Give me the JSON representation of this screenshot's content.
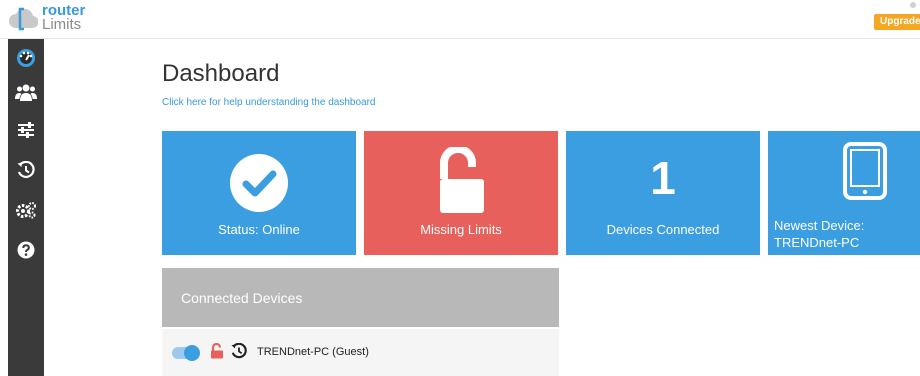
{
  "header": {
    "logo_line1": "router",
    "logo_line2": "Limits",
    "upgrade_label": "Upgrade to"
  },
  "sidebar": {
    "items": [
      {
        "icon": "dashboard-gauge-icon",
        "active": true
      },
      {
        "icon": "users-group-icon"
      },
      {
        "icon": "sliders-icon"
      },
      {
        "icon": "history-icon"
      },
      {
        "icon": "gears-icon"
      },
      {
        "icon": "help-icon"
      }
    ]
  },
  "main": {
    "title": "Dashboard",
    "help_link": "Click here for help understanding the dashboard",
    "tiles": [
      {
        "label": "Status: Online",
        "icon": "check-circle-icon",
        "color": "#3a9ee0"
      },
      {
        "label": "Missing Limits",
        "icon": "unlock-icon",
        "color": "#e8605c"
      },
      {
        "label": "Devices Connected",
        "value": "1",
        "color": "#3a9ee0"
      },
      {
        "label": "Newest Device: TRENDnet-PC",
        "icon": "tablet-icon",
        "color": "#3a9ee0"
      }
    ],
    "connected_devices": {
      "title": "Connected Devices",
      "devices": [
        {
          "name": "TRENDnet-PC (Guest)",
          "enabled": true
        }
      ]
    }
  },
  "colors": {
    "accent": "#3a9ee0",
    "danger": "#e8605c",
    "sidebar": "#3a3a3a",
    "upgrade": "#f5a623",
    "panel_head": "#b8b8b8"
  }
}
